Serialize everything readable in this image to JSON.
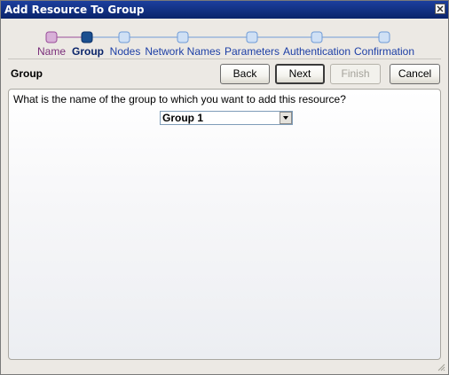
{
  "window": {
    "title": "Add Resource To Group"
  },
  "wizard": {
    "steps": [
      {
        "label": "Name",
        "state": "done"
      },
      {
        "label": "Group",
        "state": "current"
      },
      {
        "label": "Nodes",
        "state": "pending"
      },
      {
        "label": "Network Names",
        "state": "pending"
      },
      {
        "label": "Parameters",
        "state": "pending"
      },
      {
        "label": "Authentication",
        "state": "pending"
      },
      {
        "label": "Confirmation",
        "state": "pending"
      }
    ],
    "colors": {
      "done": "#b96cb9",
      "current": "#1b4f8f",
      "pending": "#a8c6ea",
      "line_done": "#9a4d9a",
      "line_pending": "#6f9bd6"
    }
  },
  "page": {
    "section_title": "Group",
    "question": "What is the name of the group to which you want to add this resource?",
    "group_select": {
      "value": "Group 1"
    }
  },
  "buttons": {
    "back": "Back",
    "next": "Next",
    "finish": "Finish",
    "cancel": "Cancel"
  }
}
